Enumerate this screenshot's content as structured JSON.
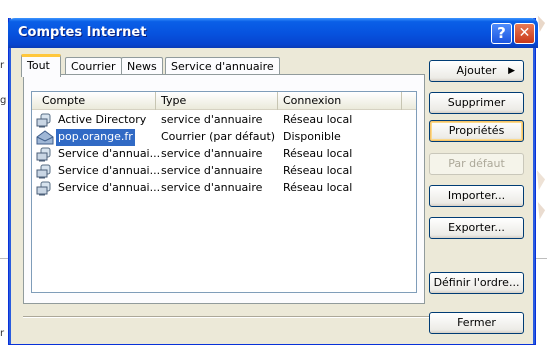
{
  "window": {
    "title": "Comptes Internet",
    "help_glyph": "?",
    "close_glyph": "✕"
  },
  "tabs": [
    {
      "label": "Tout",
      "active": true
    },
    {
      "label": "Courrier",
      "active": false
    },
    {
      "label": "News",
      "active": false
    },
    {
      "label": "Service d'annuaire",
      "active": false
    }
  ],
  "list": {
    "columns": [
      "Compte",
      "Type",
      "Connexion"
    ],
    "rows": [
      {
        "account": "Active Directory",
        "type": "service d'annuaire",
        "connection": "Réseau local",
        "icon": "directory-service-icon",
        "selected": false
      },
      {
        "account": "pop.orange.fr",
        "type": "Courrier (par défaut)",
        "connection": "Disponible",
        "icon": "mail-account-icon",
        "selected": true
      },
      {
        "account": "Service d'annuai...",
        "type": "service d'annuaire",
        "connection": "Réseau local",
        "icon": "directory-service-icon",
        "selected": false
      },
      {
        "account": "Service d'annuai...",
        "type": "service d'annuaire",
        "connection": "Réseau local",
        "icon": "directory-service-icon",
        "selected": false
      },
      {
        "account": "Service d'annuai...",
        "type": "service d'annuaire",
        "connection": "Réseau local",
        "icon": "directory-service-icon",
        "selected": false
      }
    ]
  },
  "buttons": {
    "add": "Ajouter",
    "add_arrow": "▶",
    "remove": "Supprimer",
    "properties": "Propriétés",
    "set_default": "Par défaut",
    "import": "Importer...",
    "export": "Exporter...",
    "set_order": "Définir l'ordre...",
    "close": "Fermer"
  },
  "background": {
    "glyph_1": "r",
    "glyph_2": "g",
    "glyph_3": "r"
  },
  "colors": {
    "titlebar": "#0753df",
    "selection": "#316ac5",
    "tab_highlight": "#ffc73c",
    "dialog_face": "#ece9d8"
  }
}
